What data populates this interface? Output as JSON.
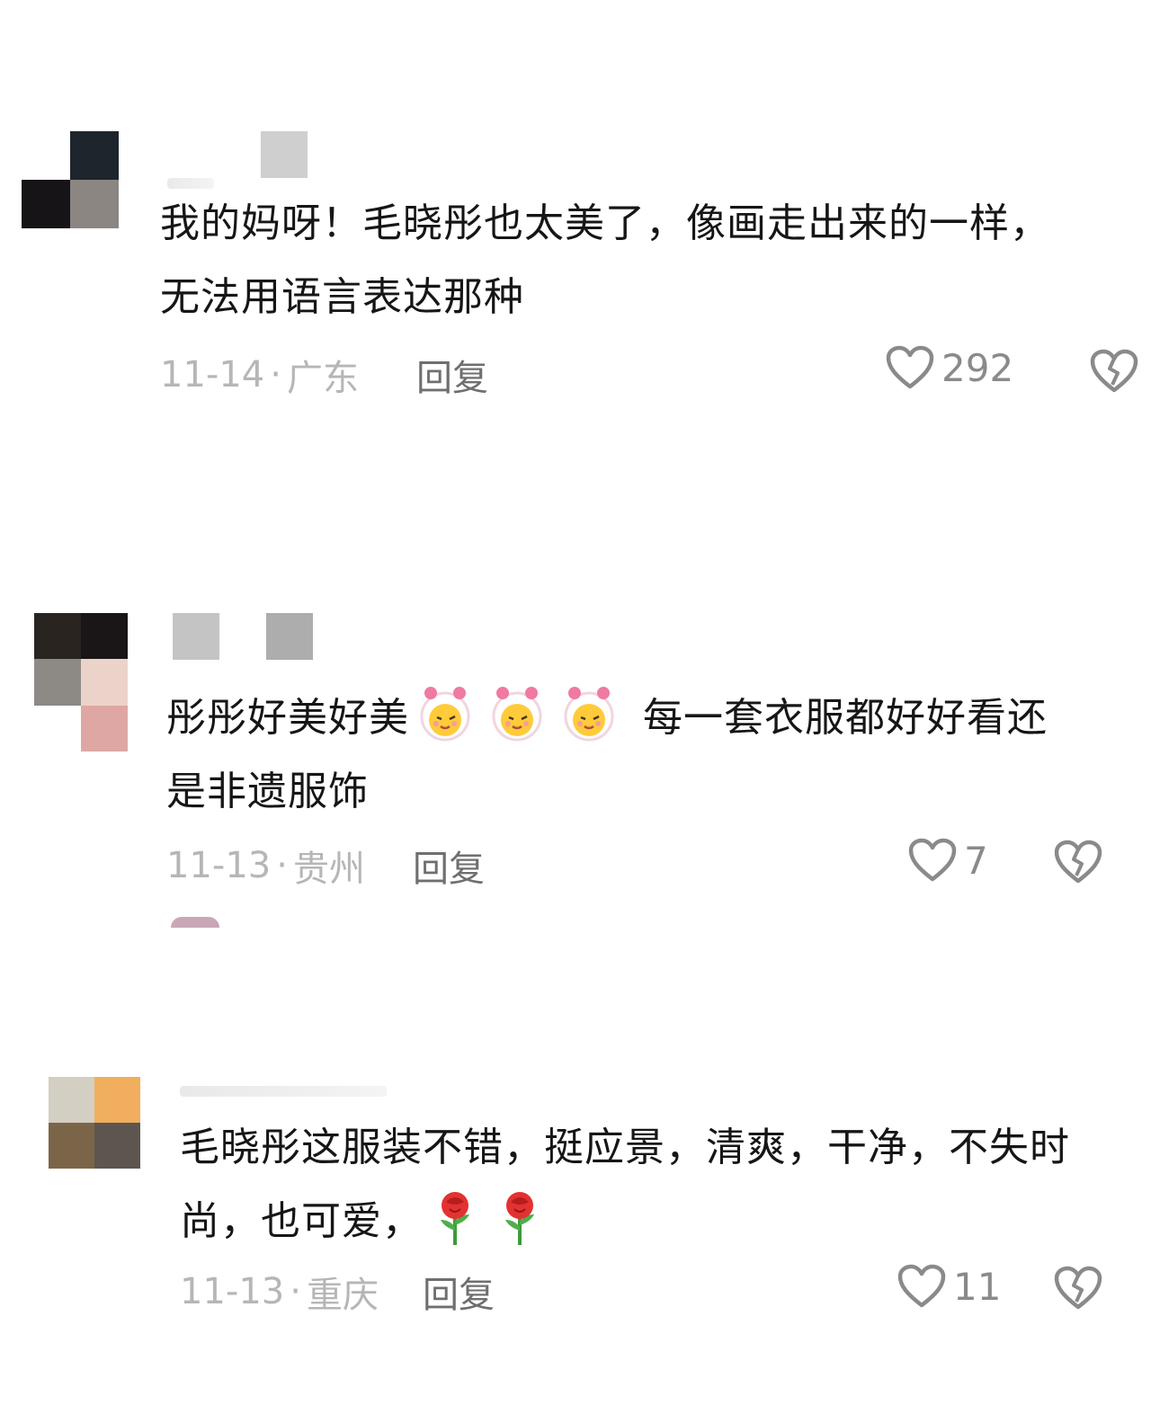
{
  "comments": [
    {
      "text": "我的妈呀！毛晓彤也太美了，像画走出来的一样，无法用语言表达那种",
      "date": "11-14",
      "location": "广东",
      "reply_label": "回复",
      "likes": "292"
    },
    {
      "text_before_emoji": "彤彤好美好美",
      "text_after_emoji": "每一套衣服都好好看还是非遗服饰",
      "emoji_count": 3,
      "date": "11-13",
      "location": "贵州",
      "reply_label": "回复",
      "likes": "7"
    },
    {
      "text_before_emoji": "毛晓彤这服装不错，挺应景，清爽，干净，不失时尚，也可爱，",
      "emoji_count": 2,
      "date": "11-13",
      "location": "重庆",
      "reply_label": "回复",
      "likes": "11"
    }
  ],
  "separator": "·",
  "icons": {
    "like": "heart-outline-icon",
    "dislike": "broken-heart-icon",
    "emoji_1": "winking-girl-emoji",
    "emoji_2": "rose-emoji"
  },
  "colors": {
    "meta": "#b6b6b6",
    "reply": "#6f6f6f",
    "icon": "#8a8a8a"
  }
}
